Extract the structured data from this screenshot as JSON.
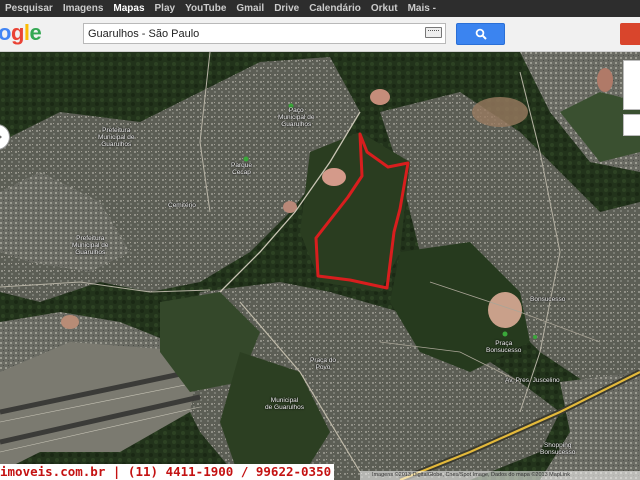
{
  "topbar": {
    "items": [
      {
        "label": "Pesquisar",
        "active": false
      },
      {
        "label": "Imagens",
        "active": false
      },
      {
        "label": "Mapas",
        "active": true
      },
      {
        "label": "Play",
        "active": false
      },
      {
        "label": "YouTube",
        "active": false
      },
      {
        "label": "Gmail",
        "active": false
      },
      {
        "label": "Drive",
        "active": false
      },
      {
        "label": "Calendário",
        "active": false
      },
      {
        "label": "Orkut",
        "active": false
      },
      {
        "label": "Mais -",
        "active": false
      }
    ]
  },
  "search": {
    "logo_letters": [
      "o",
      "g",
      "l",
      "e"
    ],
    "query": "Guarulhos - São Paulo",
    "search_icon": "magnifier-icon",
    "keyboard_icon": "keyboard-icon",
    "right_button_icon": "red-button"
  },
  "map": {
    "type": "satellite",
    "highlight_color": "#d81e1e",
    "labels": [
      {
        "text": "Prefeitura\nMunicipal de\nGuarulhos"
      },
      {
        "text": "Paço\nMunicipal de\nGuarulhos"
      },
      {
        "text": "Cemitério"
      },
      {
        "text": "Parque\nCecap"
      },
      {
        "text": "Prefeitura\nMunicipal de\nGuarulhos"
      },
      {
        "text": "Praça\nBonsucesso"
      },
      {
        "text": "Bonsucesso"
      },
      {
        "text": "Praça do\nPovo"
      },
      {
        "text": "Municipal\nde Guarulhos"
      },
      {
        "text": "Av. Pres. Juscelino"
      },
      {
        "text": "Shopping\nBonsucesso"
      }
    ],
    "attribution": "Imagens ©2013 DigitalGlobe, Cnes/Spot Image, Dados do mapa ©2013 MapLink"
  },
  "footer": {
    "text": "imoveis.com.br | (11) 4411-1900 / 99622-0350",
    "color": "#c41212"
  }
}
